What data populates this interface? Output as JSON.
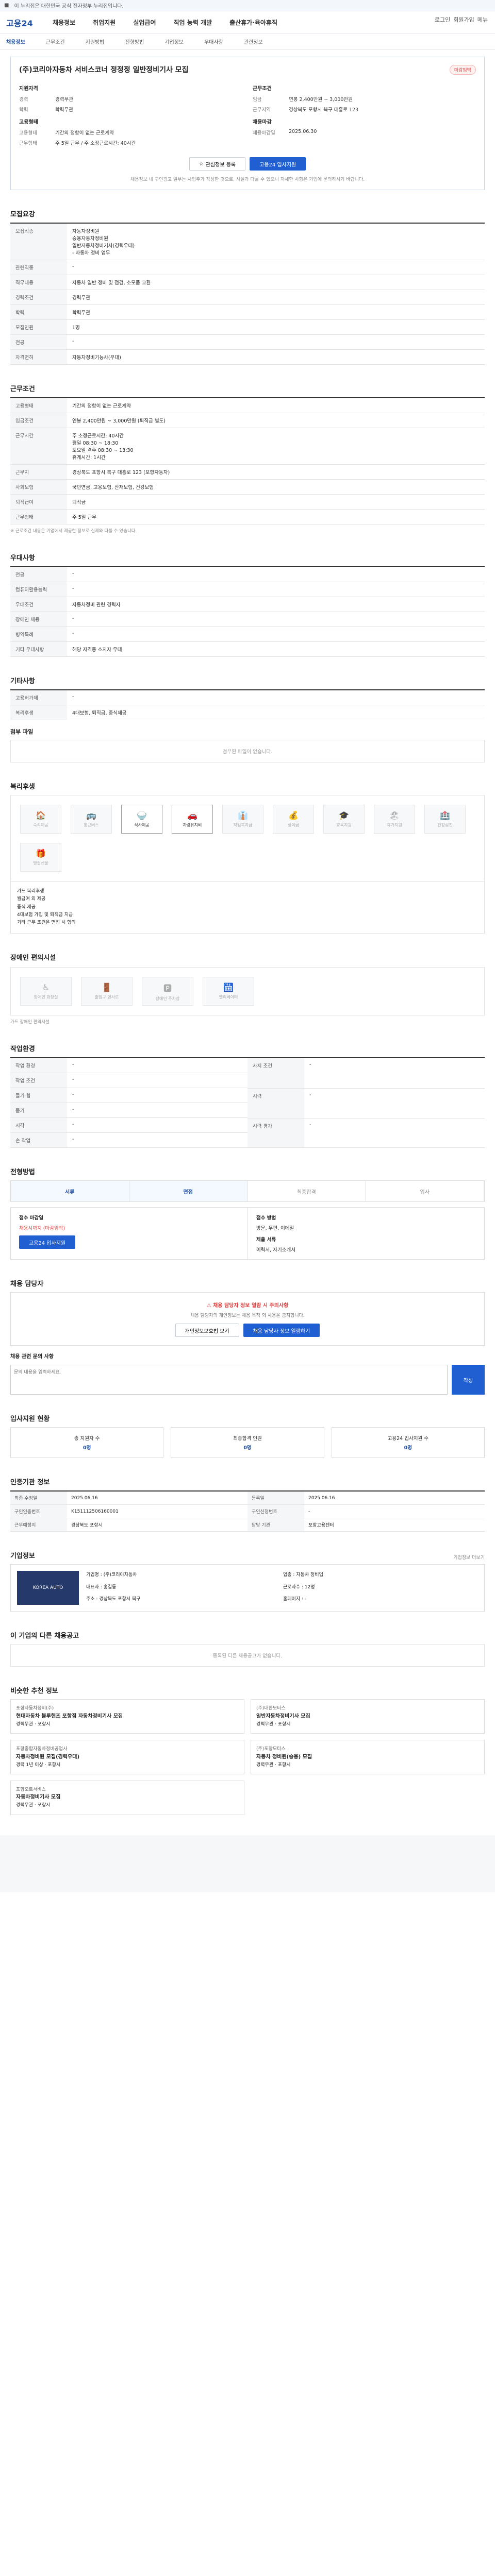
{
  "topbar": {
    "notice": "이 누리집은 대한민국 공식 전자정부 누리집입니다."
  },
  "header": {
    "logo": "고용24",
    "menu": [
      "채용정보",
      "취업지원",
      "실업급여",
      "직업 능력 개발",
      "출산휴가·육아휴직"
    ],
    "right": [
      "로그인",
      "회원가입",
      "메뉴"
    ]
  },
  "subnav": {
    "items": [
      "채용정보",
      "근무조건",
      "지원방법",
      "전형방법",
      "기업정보",
      "우대사항",
      "관련정보"
    ]
  },
  "job": {
    "title": "(주)코리아자동차 서비스코너 정정정 일반정비기사 모집",
    "badge": "마감임박",
    "left_h": "지원자격",
    "left": [
      [
        "경력",
        "경력무관"
      ],
      [
        "학력",
        "학력무관"
      ]
    ],
    "left2_h": "고용형태",
    "left2": [
      [
        "고용형태",
        "기간의 정함이 없는 근로계약"
      ],
      [
        "근무형태",
        "주 5일 근무 / 주 소정근로시간: 40시간"
      ]
    ],
    "right_h": "근무조건",
    "right": [
      [
        "임금",
        "연봉 2,400만원 ~ 3,000만원"
      ],
      [
        "근무지역",
        "경상북도 포항시 북구 대흥로 123"
      ]
    ],
    "right2_h": "채용마감",
    "right2": [
      [
        "채용마감일",
        "2025.06.30"
      ]
    ],
    "btn_save": "관심정보 등록",
    "btn_apply": "고용24 입사지원",
    "notice": "채용정보 내 구인광고 일부는 사업주가 작성한 것으로, 사실과 다를 수 있으니 자세한 사항은 기업에 문의하시기 바랍니다."
  },
  "sec_recruit": {
    "h": "모집요강",
    "rows": [
      [
        "모집직종",
        "자동차정비원\n승용자동차정비원\n일반자동차정비기사(경력우대)\n- 자동차 정비 업무"
      ],
      [
        "관련직종",
        "-"
      ],
      [
        "직무내용",
        "자동차 일반 정비 및 점검, 소모품 교환"
      ],
      [
        "경력조건",
        "경력무관"
      ],
      [
        "학력",
        "학력무관"
      ],
      [
        "모집인원",
        "1명"
      ],
      [
        "전공",
        "-"
      ],
      [
        "자격면허",
        "자동차정비기능사(우대)"
      ]
    ]
  },
  "sec_cond": {
    "h": "근무조건",
    "rows": [
      [
        "고용형태",
        "기간의 정함이 없는 근로계약"
      ],
      [
        "임금조건",
        "연봉 2,400만원 ~ 3,000만원 (퇴직금 별도)"
      ],
      [
        "근무시간",
        "주 소정근로시간: 40시간\n평일 08:30 ~ 18:30\n토요일 격주 08:30 ~ 13:30\n휴게시간: 1시간"
      ],
      [
        "근무지",
        "경상북도 포항시 북구 대흥로 123 (포항자동차)"
      ],
      [
        "사회보험",
        "국민연금, 고용보험, 산재보험, 건강보험"
      ],
      [
        "퇴직급여",
        "퇴직금"
      ],
      [
        "근무형태",
        "주 5일 근무"
      ]
    ],
    "note": "※ 근로조건 내용은 기업에서 제공한 정보로 실제와 다를 수 있습니다."
  },
  "sec_pref": {
    "h": "우대사항",
    "rows": [
      [
        "전공",
        "-"
      ],
      [
        "컴퓨터활용능력",
        "-"
      ],
      [
        "우대조건",
        "자동차정비 관련 경력자"
      ],
      [
        "장애인 채용",
        "-"
      ],
      [
        "병역특례",
        "-"
      ],
      [
        "기타 우대사항",
        "해당 자격증 소지자 우대"
      ]
    ]
  },
  "sec_etc": {
    "h": "기타사항",
    "rows": [
      [
        "고용허가제",
        "-"
      ],
      [
        "복리후생",
        "4대보험, 퇴직금, 중식제공"
      ]
    ],
    "attach_h": "첨부 파일",
    "attach": "첨부된 파일이 없습니다."
  },
  "sec_welfare": {
    "h": "복리후생",
    "icons": [
      [
        "🏠",
        "숙식제공"
      ],
      [
        "🚌",
        "통근버스"
      ],
      [
        "🍚",
        "식사제공"
      ],
      [
        "🚗",
        "차량유지비"
      ],
      [
        "👔",
        "작업복지급"
      ],
      [
        "💰",
        "상여금"
      ],
      [
        "🎓",
        "교육지원"
      ],
      [
        "🏖",
        "휴가지원"
      ],
      [
        "🏥",
        "건강검진"
      ],
      [
        "🎁",
        "명절선물"
      ]
    ],
    "on": [
      2,
      3
    ],
    "notes": [
      "가드 복리후생",
      "월급여 외 제공",
      "중식 제공",
      "4대보험 가입 및 퇴직금 지급",
      "기타 근무 조건은 면접 시 협의"
    ]
  },
  "sec_disab": {
    "h": "장애인 편의시설",
    "icons": [
      [
        "♿",
        "장애인 화장실"
      ],
      [
        "🚪",
        "출입구 경사로"
      ],
      [
        "🅿",
        "장애인 주차장"
      ],
      [
        "🛗",
        "엘리베이터"
      ]
    ],
    "note": "가드 장애인 편의시설"
  },
  "sec_env": {
    "h": "작업환경",
    "rows": [
      [
        "작업 환경",
        "-"
      ],
      [
        "작업 조건",
        "-"
      ],
      [
        "들기 힘",
        "-"
      ],
      [
        "듣기",
        "-"
      ],
      [
        "시각",
        "-"
      ],
      [
        "손 작업",
        "-"
      ]
    ],
    "rows2": [
      [
        "사지 조건",
        "-"
      ],
      [
        "시력",
        "-"
      ],
      [
        "시력 평가",
        "-"
      ]
    ]
  },
  "sec_proc": {
    "h": "전형방법",
    "steps": [
      "서류",
      "면접",
      "최종합격",
      "입사"
    ],
    "apply_h": "접수 마감일",
    "apply_v": "채용시까지 (마감임박)",
    "method_h": "접수 방법",
    "method": [
      "고용24 입사지원",
      "방문, 우편, 이메일"
    ],
    "docs_h": "제출 서류",
    "docs": "이력서, 자기소개서"
  },
  "sec_qa": {
    "h": "채용 담당자",
    "warn": "채용 담당자 정보 열람 시 주의사항",
    "desc": "채용 담당자의 개인정보는 채용 목적 외 사용을 금지합니다.",
    "btn1": "개인정보보호법 보기",
    "btn2": "채용 담당자 정보 열람하기",
    "q_h": "채용 관련 문의 사항",
    "placeholder": "문의 내용을 입력하세요.",
    "send": "작성"
  },
  "sec_stat": {
    "h": "입사지원 현황",
    "cards": [
      [
        "총 지원자 수",
        "0명"
      ],
      [
        "최종합격 인원",
        "0명"
      ],
      [
        "고용24 입사지원 수",
        "0명"
      ]
    ]
  },
  "sec_info": {
    "h": "인증기관 정보",
    "rows": [
      [
        "최종 수정일",
        "2025.06.16"
      ],
      [
        "구인인증번호",
        "K151112506160001"
      ],
      [
        "근무예정지",
        "경상북도 포항시"
      ]
    ],
    "rows2": [
      [
        "등록일",
        "2025.06.16"
      ],
      [
        "구인신청번호",
        "-"
      ],
      [
        "담당 기관",
        "포항고용센터"
      ]
    ]
  },
  "sec_comp": {
    "h": "기업정보",
    "logo": "KOREA AUTO",
    "info": [
      [
        "기업명",
        "(주)코리아자동차"
      ],
      [
        "업종",
        "자동차 정비업"
      ],
      [
        "대표자",
        "홍길동"
      ],
      [
        "근로자수",
        "12명"
      ],
      [
        "주소",
        "경상북도 포항시 북구"
      ],
      [
        "홈페이지",
        "-"
      ]
    ],
    "more": "기업정보 더보기"
  },
  "sec_other": {
    "h": "이 기업의 다른 채용공고",
    "empty": "등록된 다른 채용공고가 없습니다."
  },
  "sec_rel": {
    "h": "비슷한 추천 정보",
    "cards": [
      [
        "포항자동차정비(주)",
        "현대자동차 블루핸즈 포항점 자동차정비기사 모집",
        "경력무관",
        "포항시"
      ],
      [
        "(주)대한모터스",
        "일반자동차정비기사 모집",
        "경력무관",
        "포항시"
      ],
      [
        "포항종합자동차정비공업사",
        "자동차정비원 모집(경력우대)",
        "경력 1년 이상",
        "포항시"
      ],
      [
        "(주)포항모터스",
        "자동차 정비원(승용) 모집",
        "경력무관",
        "포항시"
      ],
      [
        "포항오토서비스",
        "자동차정비기사 모집",
        "경력무관",
        "포항시"
      ],
      [
        "",
        "",
        "",
        ""
      ]
    ]
  }
}
